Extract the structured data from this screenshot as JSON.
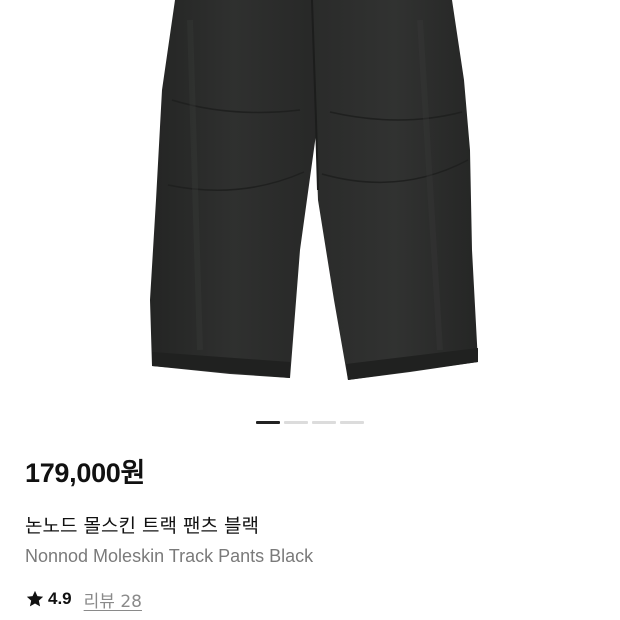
{
  "product": {
    "image_icon": "product-photo-black-track-pants",
    "carousel": {
      "total_slides": 4,
      "active_slide": 1
    },
    "price": "179,000원",
    "title_ko": "논노드 몰스킨 트랙 팬츠 블랙",
    "title_en": "Nonnod Moleskin Track Pants Black",
    "rating": {
      "icon": "star-icon",
      "value": "4.9",
      "reviews_label": "리뷰 28"
    }
  },
  "colors": {
    "pants": "#2b2c2b",
    "price_text": "#111111",
    "subtitle_text": "#7a7a7a",
    "review_link": "#8a8a8a",
    "dot_active": "#222222",
    "dot_inactive": "#dcdcdc"
  }
}
